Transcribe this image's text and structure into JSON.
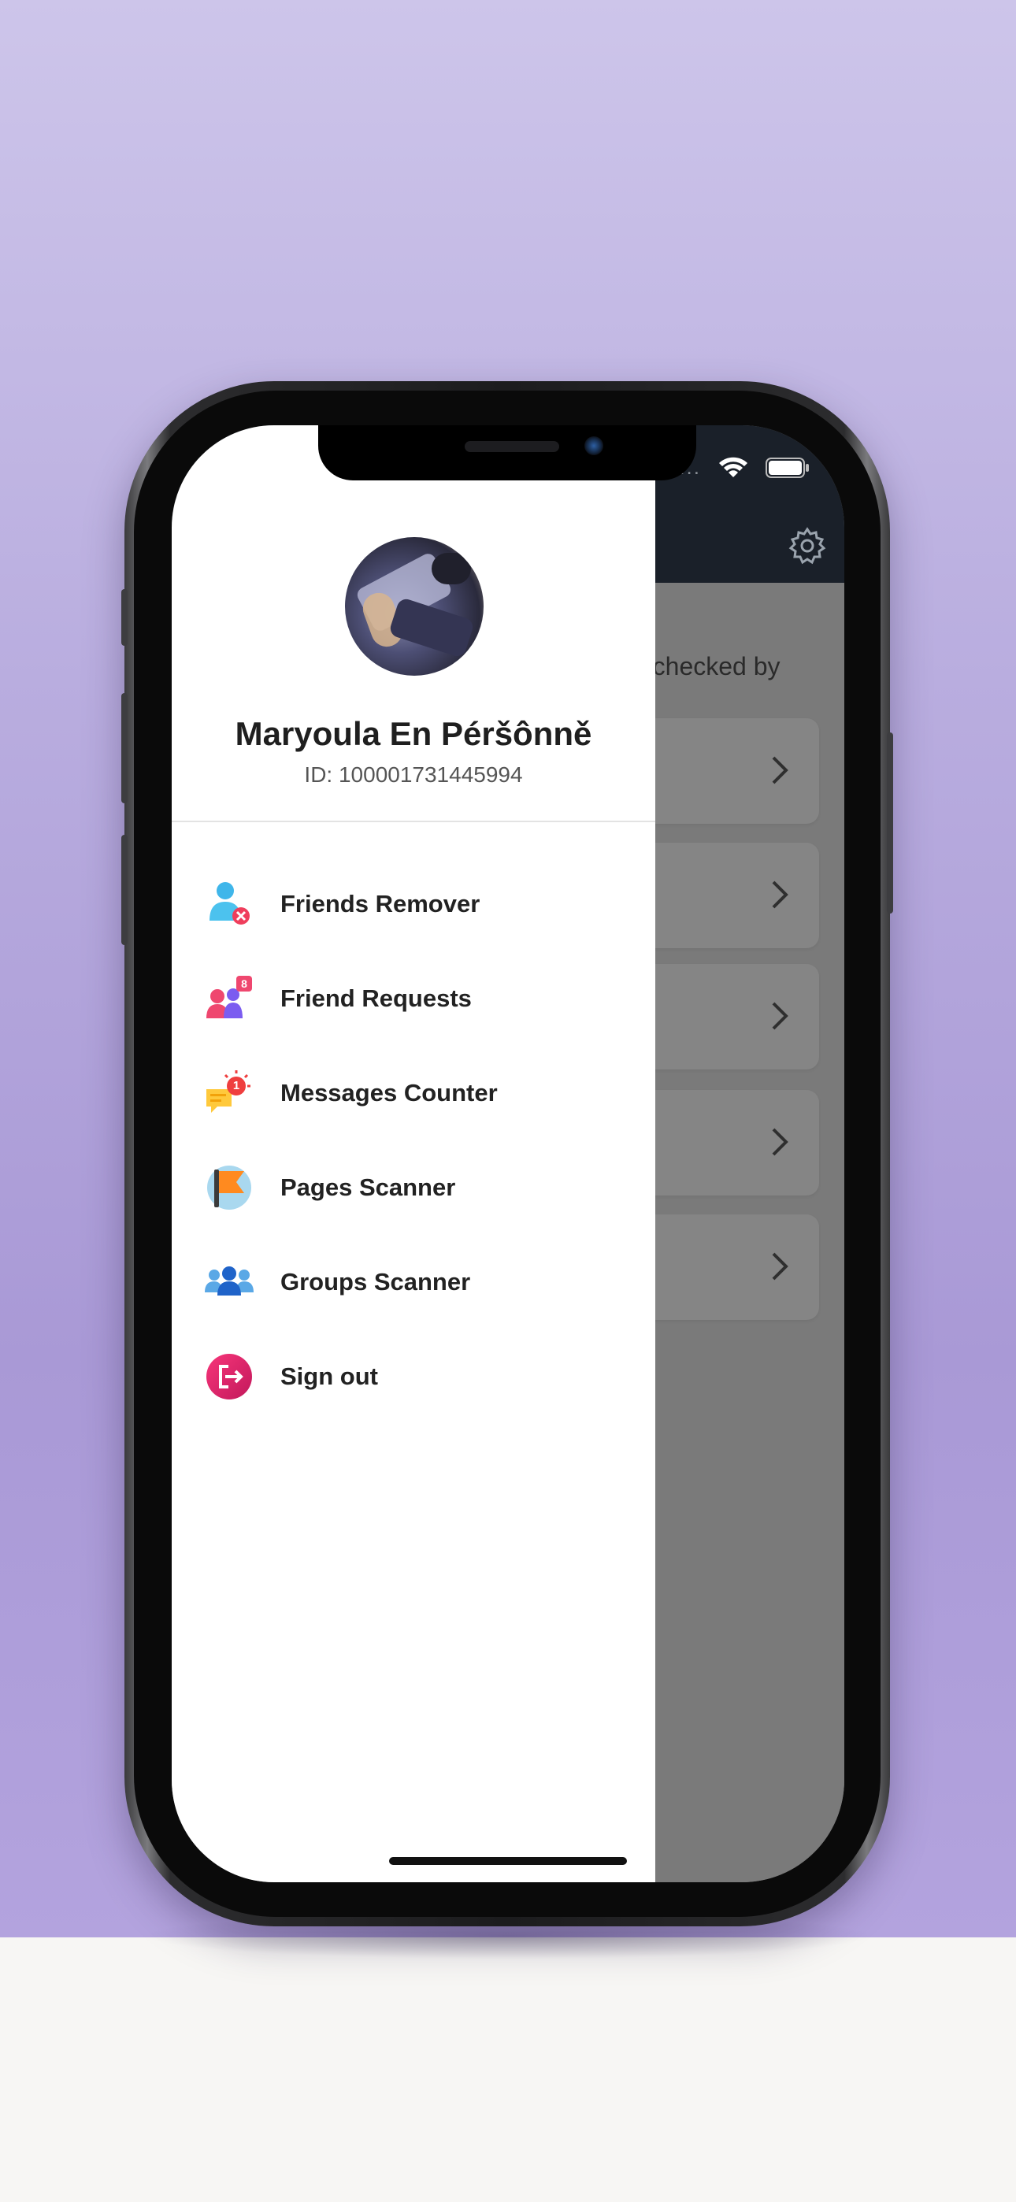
{
  "status_bar": {
    "signal": "....",
    "wifi_icon": "wifi-icon",
    "battery_icon": "battery-icon"
  },
  "drawer": {
    "user": {
      "name": "Maryoula En Péršônně",
      "id_text": "ID: 100001731445994"
    },
    "menu": [
      {
        "label": "Friends Remover",
        "icon": "friends-remover-icon"
      },
      {
        "label": "Friend Requests",
        "icon": "friend-requests-icon"
      },
      {
        "label": "Messages Counter",
        "icon": "messages-counter-icon"
      },
      {
        "label": "Pages Scanner",
        "icon": "pages-scanner-icon"
      },
      {
        "label": "Groups Scanner",
        "icon": "groups-scanner-icon"
      },
      {
        "label": "Sign out",
        "icon": "sign-out-icon"
      }
    ],
    "badges": {
      "friend_requests": "8",
      "messages": "1"
    }
  },
  "background_app": {
    "intro_text": "(checked by",
    "settings_icon": "gear-icon",
    "cards": [
      "card-1",
      "card-2",
      "card-3",
      "card-4",
      "card-5"
    ]
  },
  "colors": {
    "drawer_bg": "#ffffff",
    "header_bg": "#1a2029",
    "dim_overlay": "#7a7a7a",
    "backdrop": "#b9addf",
    "sign_out": "#e91e63"
  }
}
